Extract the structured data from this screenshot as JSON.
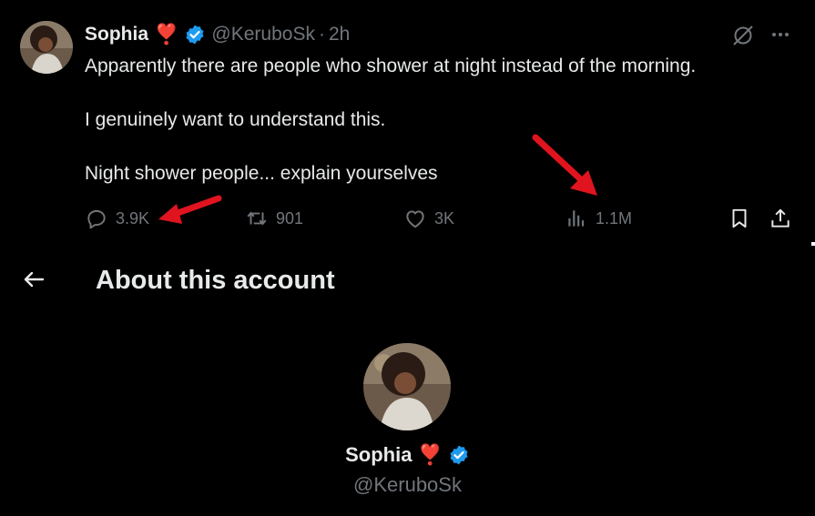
{
  "tweet": {
    "author_name": "Sophia",
    "heart_emoji": "❣️",
    "handle": "@KeruboSk",
    "separator": "·",
    "time": "2h",
    "lines": [
      "Apparently there are people who shower at night instead of the morning.",
      "I genuinely want to understand this.",
      "Night shower people... explain yourselves"
    ],
    "actions": {
      "replies": "3.9K",
      "reposts": "901",
      "likes": "3K",
      "views": "1.1M"
    }
  },
  "about": {
    "title": "About this account",
    "name": "Sophia",
    "heart_emoji": "❣️",
    "handle": "@KeruboSk"
  },
  "colors": {
    "background": "#000000",
    "text": "#e7e9ea",
    "muted": "#71767b",
    "verified": "#1d9bf0",
    "annotation_arrow": "#e0141e"
  },
  "icons": [
    "grok-icon",
    "more-icon",
    "reply-icon",
    "repost-icon",
    "like-icon",
    "views-icon",
    "bookmark-icon",
    "share-icon",
    "back-arrow-icon",
    "verified-icon"
  ]
}
